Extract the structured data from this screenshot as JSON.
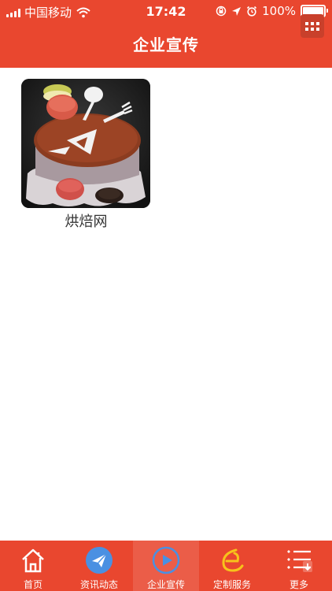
{
  "status": {
    "carrier": "中国移动",
    "time": "17:42",
    "battery": "100%"
  },
  "header": {
    "title": "企业宣传",
    "menu_icon": "grid-icon"
  },
  "items": [
    {
      "label": "烘焙网",
      "image": "cake-photo"
    }
  ],
  "tabs": [
    {
      "label": "首页",
      "icon": "home-icon"
    },
    {
      "label": "资讯动态",
      "icon": "paper-plane-icon"
    },
    {
      "label": "企业宣传",
      "icon": "play-icon",
      "active": true
    },
    {
      "label": "定制服务",
      "icon": "service-icon"
    },
    {
      "label": "更多",
      "icon": "more-list-icon"
    }
  ],
  "colors": {
    "primary": "#e9472f",
    "blue_accent": "#4a90e2",
    "yellow_accent": "#f7c31b"
  }
}
